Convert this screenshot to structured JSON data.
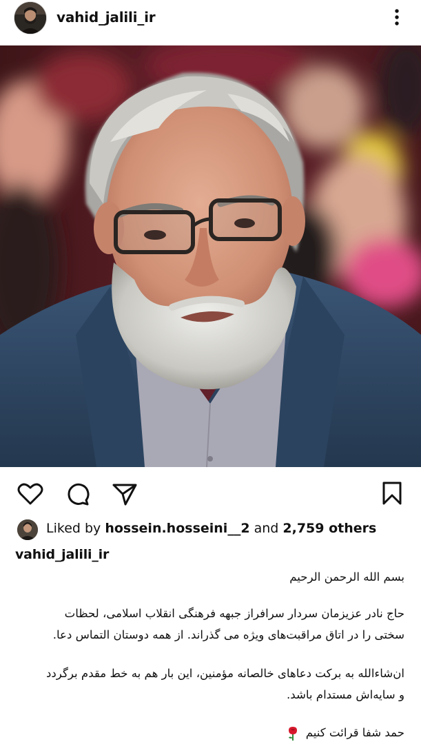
{
  "header": {
    "username": "vahid_jalili_ir",
    "avatar_icon": "profile-avatar",
    "menu_icon": "more-vertical-icon"
  },
  "post": {
    "image_icon": "portrait-photo",
    "actions": [
      {
        "name": "like",
        "icon": "heart-icon"
      },
      {
        "name": "comment",
        "icon": "comment-icon"
      },
      {
        "name": "share",
        "icon": "send-icon"
      },
      {
        "name": "save",
        "icon": "bookmark-icon"
      }
    ],
    "likes": {
      "prefix": "Liked by",
      "user": "hossein.hosseini__2",
      "joiner": "and",
      "others": "2,759 others"
    },
    "caption": {
      "username": "vahid_jalili_ir",
      "line1": "بسم الله الرحمن الرحیم",
      "para1_line1": "حاج نادر عزیزمان سردار سرافراز جبهه فرهنگی انقلاب اسلامی، لحظات",
      "para1_line2": "سختی را در اتاق مراقبت‌های ویژه می گذراند. از همه دوستان التماس دعا.",
      "para2_line1": "ان‌شاءالله به برکت دعاهای خالصانه مؤمنین، این بار هم به خط مقدم برگردد",
      "para2_line2": "و سایه‌اش مستدام باشد.",
      "last_line": "حمد شفا قرائت کنیم",
      "rose_icon": "rose-icon"
    }
  },
  "colors": {
    "text": "#111111",
    "background": "#ffffff",
    "photo_backdrop": "#4d1a1f",
    "jacket": "#2f4965"
  }
}
